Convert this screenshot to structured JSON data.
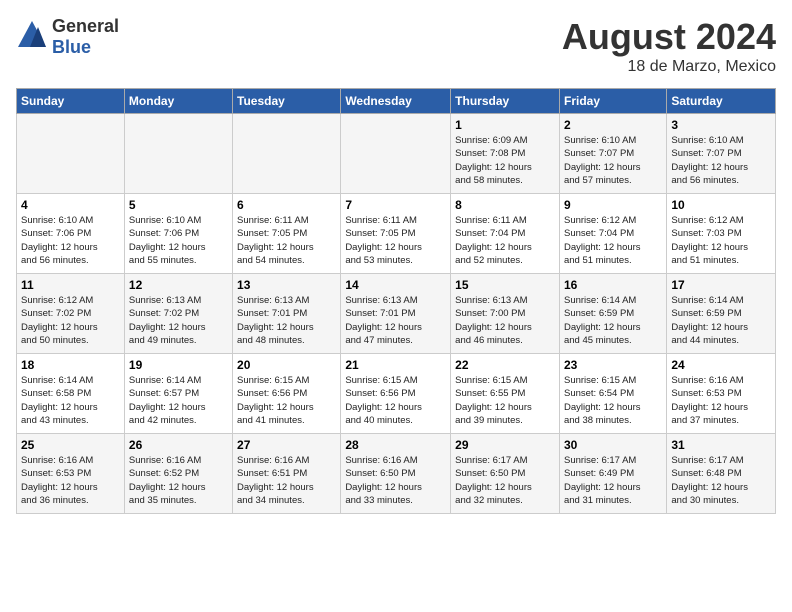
{
  "header": {
    "logo_general": "General",
    "logo_blue": "Blue",
    "main_title": "August 2024",
    "sub_title": "18 de Marzo, Mexico"
  },
  "calendar": {
    "days_of_week": [
      "Sunday",
      "Monday",
      "Tuesday",
      "Wednesday",
      "Thursday",
      "Friday",
      "Saturday"
    ],
    "weeks": [
      [
        {
          "day": "",
          "info": ""
        },
        {
          "day": "",
          "info": ""
        },
        {
          "day": "",
          "info": ""
        },
        {
          "day": "",
          "info": ""
        },
        {
          "day": "1",
          "info": "Sunrise: 6:09 AM\nSunset: 7:08 PM\nDaylight: 12 hours\nand 58 minutes."
        },
        {
          "day": "2",
          "info": "Sunrise: 6:10 AM\nSunset: 7:07 PM\nDaylight: 12 hours\nand 57 minutes."
        },
        {
          "day": "3",
          "info": "Sunrise: 6:10 AM\nSunset: 7:07 PM\nDaylight: 12 hours\nand 56 minutes."
        }
      ],
      [
        {
          "day": "4",
          "info": "Sunrise: 6:10 AM\nSunset: 7:06 PM\nDaylight: 12 hours\nand 56 minutes."
        },
        {
          "day": "5",
          "info": "Sunrise: 6:10 AM\nSunset: 7:06 PM\nDaylight: 12 hours\nand 55 minutes."
        },
        {
          "day": "6",
          "info": "Sunrise: 6:11 AM\nSunset: 7:05 PM\nDaylight: 12 hours\nand 54 minutes."
        },
        {
          "day": "7",
          "info": "Sunrise: 6:11 AM\nSunset: 7:05 PM\nDaylight: 12 hours\nand 53 minutes."
        },
        {
          "day": "8",
          "info": "Sunrise: 6:11 AM\nSunset: 7:04 PM\nDaylight: 12 hours\nand 52 minutes."
        },
        {
          "day": "9",
          "info": "Sunrise: 6:12 AM\nSunset: 7:04 PM\nDaylight: 12 hours\nand 51 minutes."
        },
        {
          "day": "10",
          "info": "Sunrise: 6:12 AM\nSunset: 7:03 PM\nDaylight: 12 hours\nand 51 minutes."
        }
      ],
      [
        {
          "day": "11",
          "info": "Sunrise: 6:12 AM\nSunset: 7:02 PM\nDaylight: 12 hours\nand 50 minutes."
        },
        {
          "day": "12",
          "info": "Sunrise: 6:13 AM\nSunset: 7:02 PM\nDaylight: 12 hours\nand 49 minutes."
        },
        {
          "day": "13",
          "info": "Sunrise: 6:13 AM\nSunset: 7:01 PM\nDaylight: 12 hours\nand 48 minutes."
        },
        {
          "day": "14",
          "info": "Sunrise: 6:13 AM\nSunset: 7:01 PM\nDaylight: 12 hours\nand 47 minutes."
        },
        {
          "day": "15",
          "info": "Sunrise: 6:13 AM\nSunset: 7:00 PM\nDaylight: 12 hours\nand 46 minutes."
        },
        {
          "day": "16",
          "info": "Sunrise: 6:14 AM\nSunset: 6:59 PM\nDaylight: 12 hours\nand 45 minutes."
        },
        {
          "day": "17",
          "info": "Sunrise: 6:14 AM\nSunset: 6:59 PM\nDaylight: 12 hours\nand 44 minutes."
        }
      ],
      [
        {
          "day": "18",
          "info": "Sunrise: 6:14 AM\nSunset: 6:58 PM\nDaylight: 12 hours\nand 43 minutes."
        },
        {
          "day": "19",
          "info": "Sunrise: 6:14 AM\nSunset: 6:57 PM\nDaylight: 12 hours\nand 42 minutes."
        },
        {
          "day": "20",
          "info": "Sunrise: 6:15 AM\nSunset: 6:56 PM\nDaylight: 12 hours\nand 41 minutes."
        },
        {
          "day": "21",
          "info": "Sunrise: 6:15 AM\nSunset: 6:56 PM\nDaylight: 12 hours\nand 40 minutes."
        },
        {
          "day": "22",
          "info": "Sunrise: 6:15 AM\nSunset: 6:55 PM\nDaylight: 12 hours\nand 39 minutes."
        },
        {
          "day": "23",
          "info": "Sunrise: 6:15 AM\nSunset: 6:54 PM\nDaylight: 12 hours\nand 38 minutes."
        },
        {
          "day": "24",
          "info": "Sunrise: 6:16 AM\nSunset: 6:53 PM\nDaylight: 12 hours\nand 37 minutes."
        }
      ],
      [
        {
          "day": "25",
          "info": "Sunrise: 6:16 AM\nSunset: 6:53 PM\nDaylight: 12 hours\nand 36 minutes."
        },
        {
          "day": "26",
          "info": "Sunrise: 6:16 AM\nSunset: 6:52 PM\nDaylight: 12 hours\nand 35 minutes."
        },
        {
          "day": "27",
          "info": "Sunrise: 6:16 AM\nSunset: 6:51 PM\nDaylight: 12 hours\nand 34 minutes."
        },
        {
          "day": "28",
          "info": "Sunrise: 6:16 AM\nSunset: 6:50 PM\nDaylight: 12 hours\nand 33 minutes."
        },
        {
          "day": "29",
          "info": "Sunrise: 6:17 AM\nSunset: 6:50 PM\nDaylight: 12 hours\nand 32 minutes."
        },
        {
          "day": "30",
          "info": "Sunrise: 6:17 AM\nSunset: 6:49 PM\nDaylight: 12 hours\nand 31 minutes."
        },
        {
          "day": "31",
          "info": "Sunrise: 6:17 AM\nSunset: 6:48 PM\nDaylight: 12 hours\nand 30 minutes."
        }
      ]
    ]
  }
}
